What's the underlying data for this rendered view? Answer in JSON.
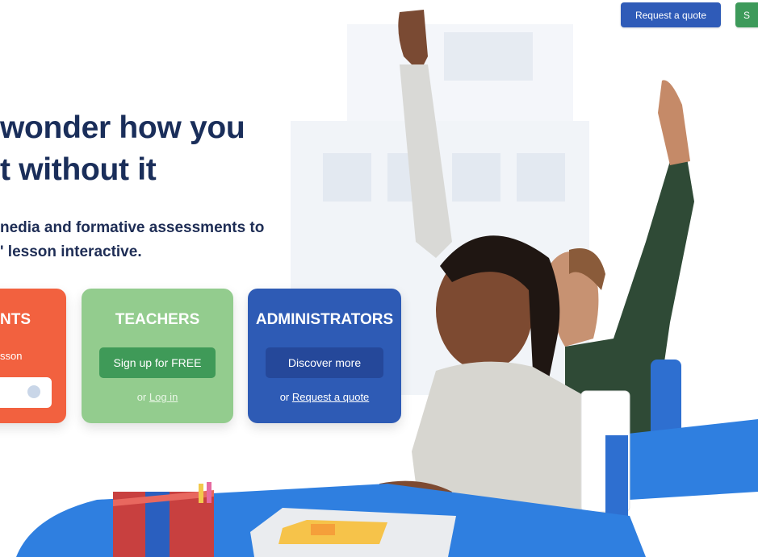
{
  "header": {
    "request_quote_label": "Request a quote",
    "green_button_label": "S"
  },
  "hero": {
    "headline_line1": "wonder how you",
    "headline_line2": "t without it",
    "subtitle_line1": "nedia and formative assessments to",
    "subtitle_line2": "' lesson interactive."
  },
  "cards": {
    "students": {
      "title": "NTS",
      "lesson_text": "sson",
      "color": "#f2613f"
    },
    "teachers": {
      "title": "TEACHERS",
      "button_label": "Sign up for FREE",
      "or_text": "or ",
      "link_label": "Log in",
      "color": "#93cc8e"
    },
    "administrators": {
      "title": "ADMINISTRATORS",
      "button_label": "Discover more",
      "or_text": "or ",
      "link_label": "Request a quote",
      "color": "#2e5bb5"
    }
  },
  "colors": {
    "headline": "#1a2e5a",
    "brand_blue": "#2f5bb8",
    "brand_green": "#3d9a5a"
  },
  "illustration": {
    "description_icon": "classroom-students-raising-hands-illustration"
  }
}
